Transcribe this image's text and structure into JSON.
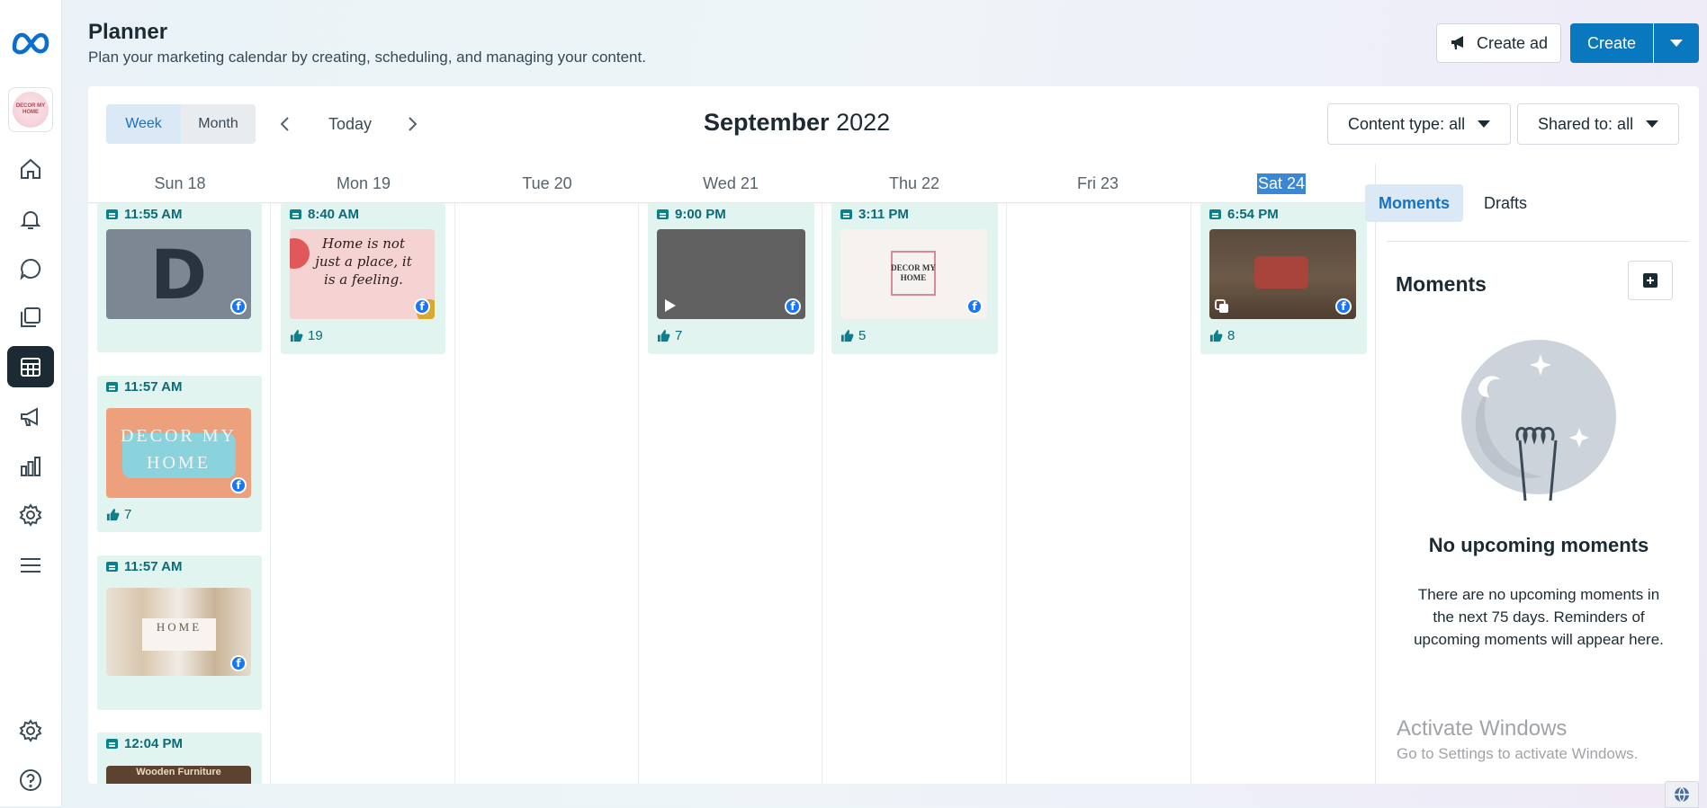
{
  "header": {
    "title": "Planner",
    "subtitle": "Plan your marketing calendar by creating, scheduling, and managing your content.",
    "create_ad_label": "Create ad",
    "create_label": "Create"
  },
  "page_avatar_text": "DECOR MY HOME",
  "toolbar": {
    "week_label": "Week",
    "month_label": "Month",
    "today_label": "Today",
    "month_name": "September",
    "year": "2022",
    "content_filter": "Content type: all",
    "shared_filter": "Shared to: all"
  },
  "days": [
    "Sun 18",
    "Mon 19",
    "Tue 20",
    "Wed 21",
    "Thu 22",
    "Fri 23",
    "Sat 24"
  ],
  "selected_day": "Sat 24",
  "posts": [
    {
      "day": "Sun 18",
      "time": "11:55 AM",
      "likes": "",
      "thumb_text": "D"
    },
    {
      "day": "Sun 18",
      "time": "11:57 AM",
      "likes": "7",
      "thumb_text": "DECOR MY HOME"
    },
    {
      "day": "Sun 18",
      "time": "11:57 AM",
      "likes": "",
      "thumb_text": "HOME"
    },
    {
      "day": "Sun 18",
      "time": "12:04 PM",
      "likes": "",
      "thumb_text": "Wooden Furniture"
    },
    {
      "day": "Mon 19",
      "time": "8:40 AM",
      "likes": "19",
      "thumb_text": "Home is not just a place, it is a feeling."
    },
    {
      "day": "Wed 21",
      "time": "9:00 PM",
      "likes": "7",
      "thumb_text": ""
    },
    {
      "day": "Thu 22",
      "time": "3:11 PM",
      "likes": "5",
      "thumb_text": "DECOR MY HOME"
    },
    {
      "day": "Sat 24",
      "time": "6:54 PM",
      "likes": "8",
      "thumb_text": ""
    }
  ],
  "sidebar": {
    "tabs": [
      "Moments",
      "Drafts"
    ],
    "active_tab": "Moments",
    "title": "Moments",
    "empty_title": "No upcoming moments",
    "empty_text": "There are no upcoming moments in the next 75 days. Reminders of upcoming moments will appear here."
  },
  "watermark": {
    "line1": "Activate Windows",
    "line2": "Go to Settings to activate Windows."
  },
  "colors": {
    "accent": "#0a78be",
    "card_bg": "#e2f4ef",
    "time_text": "#0c6b78",
    "facebook": "#1877f2"
  },
  "icons": {
    "nav": [
      "home-icon",
      "bell-icon",
      "chat-icon",
      "content-icon",
      "planner-icon",
      "megaphone-icon",
      "insights-icon",
      "settings-icon",
      "menu-icon",
      "settings-icon",
      "help-icon"
    ]
  }
}
